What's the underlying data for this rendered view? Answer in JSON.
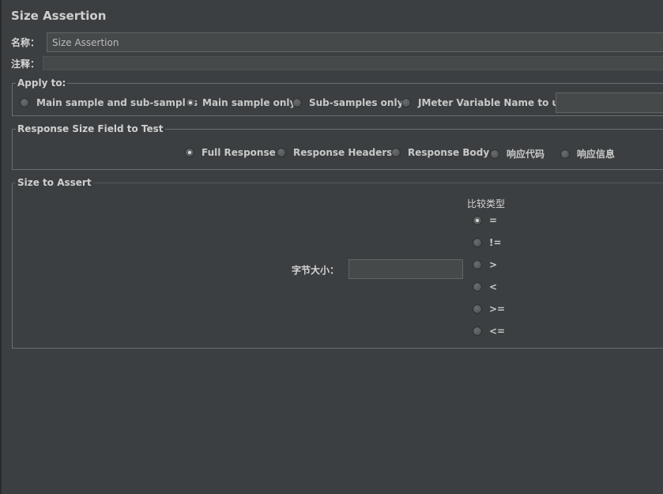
{
  "title": "Size Assertion",
  "name_field": {
    "label": "名称：",
    "value": "Size Assertion"
  },
  "comment_field": {
    "label": "注释：",
    "value": ""
  },
  "apply_to": {
    "title": "Apply to:",
    "options": [
      {
        "label": "Main sample and sub-samples",
        "selected": false
      },
      {
        "label": "Main sample only",
        "selected": true
      },
      {
        "label": "Sub-samples only",
        "selected": false
      },
      {
        "label": "JMeter Variable Name to use",
        "selected": false
      }
    ],
    "variable_value": ""
  },
  "response_field": {
    "title": "Response Size Field to Test",
    "options": [
      {
        "label": "Full Response",
        "selected": true
      },
      {
        "label": "Response Headers",
        "selected": false
      },
      {
        "label": "Response Body",
        "selected": false
      },
      {
        "label": "响应代码",
        "selected": false
      },
      {
        "label": "响应信息",
        "selected": false
      }
    ]
  },
  "size_to_assert": {
    "title": "Size to Assert",
    "size_label": "字节大小：",
    "size_value": "",
    "compare_label": "比较类型",
    "operators": [
      {
        "label": "=",
        "selected": true
      },
      {
        "label": "!=",
        "selected": false
      },
      {
        "label": ">",
        "selected": false
      },
      {
        "label": "<",
        "selected": false
      },
      {
        "label": ">=",
        "selected": false
      },
      {
        "label": "<=",
        "selected": false
      }
    ]
  }
}
